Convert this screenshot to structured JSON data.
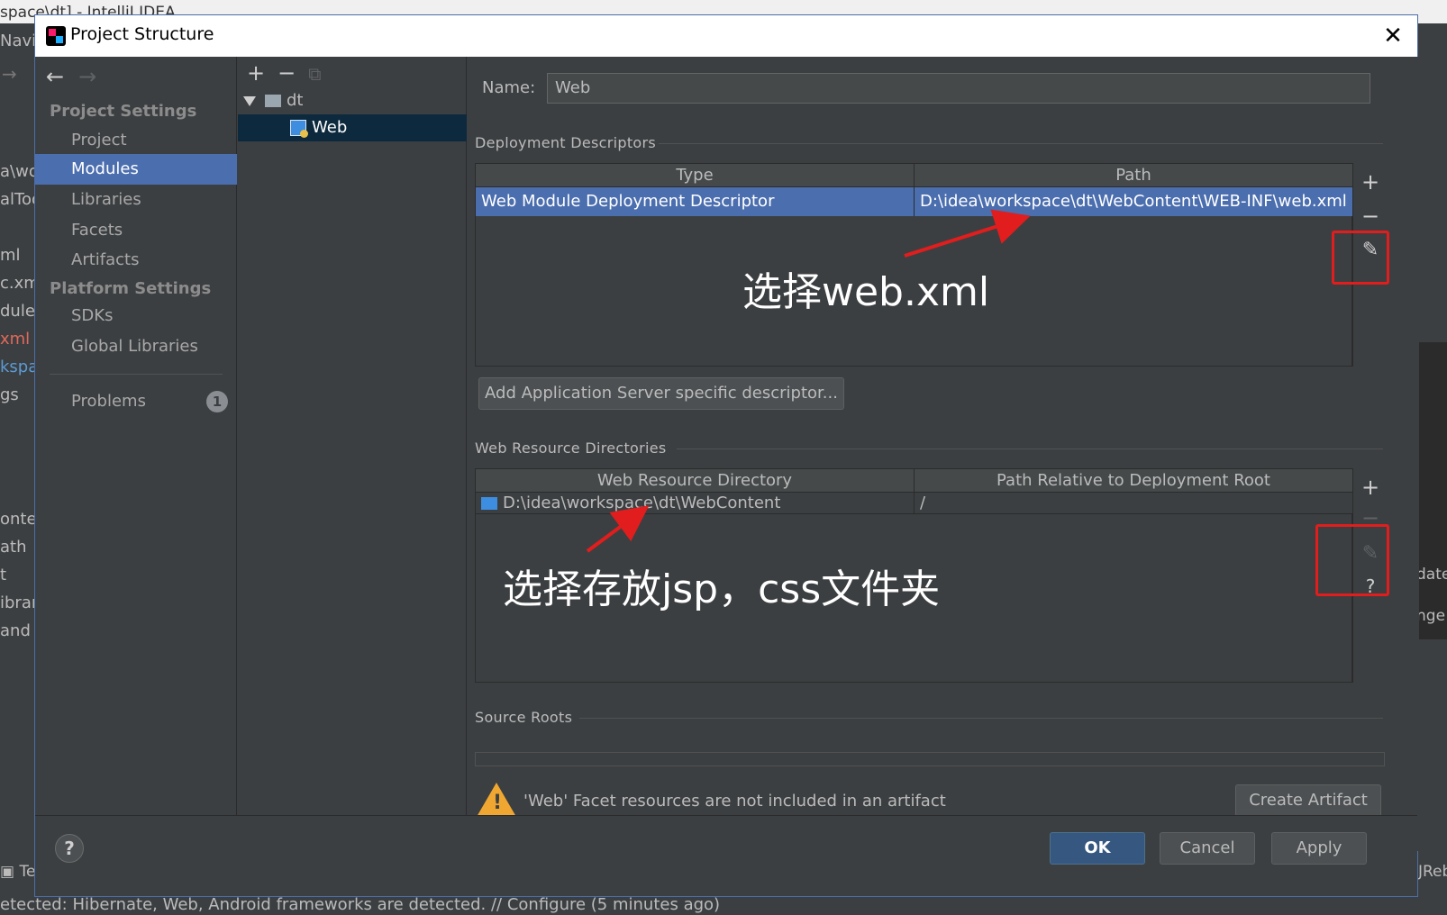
{
  "background_ide": {
    "title_fragment": "space\\dt] - IntelliJ IDEA",
    "menu_fragment": "Navig",
    "left_items": [
      "a\\wo",
      "alToo",
      "",
      "ml",
      "c.xm",
      "dules",
      "xml",
      "kspa",
      "gs"
    ],
    "left_items2": [
      "onten",
      "ath",
      "t",
      "ibrar",
      "and"
    ],
    "right_fragments": [
      "date",
      "nge"
    ],
    "bottom_tool": "Te",
    "bottom_tool_right": "JReb",
    "status_text": "etected: Hibernate, Web, Android frameworks are detected. // Configure (5 minutes ago)"
  },
  "dialog": {
    "title": "Project Structure",
    "close_glyph": "✕"
  },
  "nav": {
    "back_glyph": "←",
    "forward_glyph": "→",
    "sections": [
      {
        "title": "Project Settings",
        "items": [
          "Project",
          "Modules",
          "Libraries",
          "Facets",
          "Artifacts"
        ]
      },
      {
        "title": "Platform Settings",
        "items": [
          "SDKs",
          "Global Libraries"
        ]
      }
    ],
    "selected": "Modules",
    "problems_label": "Problems",
    "problems_count": "1"
  },
  "tree": {
    "toolbar": {
      "add": "+",
      "remove": "−",
      "copy": "⧉"
    },
    "root": "dt",
    "child": "Web"
  },
  "content": {
    "name_label": "Name:",
    "name_value": "Web",
    "deployment": {
      "title": "Deployment Descriptors",
      "columns": [
        "Type",
        "Path"
      ],
      "rows": [
        {
          "type": "Web Module Deployment Descriptor",
          "path": "D:\\idea\\workspace\\dt\\WebContent\\WEB-INF\\web.xml"
        }
      ],
      "add_server_button": "Add Application Server specific descriptor..."
    },
    "web_resources": {
      "title": "Web Resource Directories",
      "columns": [
        "Web Resource Directory",
        "Path Relative to Deployment Root"
      ],
      "rows": [
        {
          "dir": "D:\\idea\\workspace\\dt\\WebContent",
          "rel": "/"
        }
      ]
    },
    "source_roots_title": "Source Roots",
    "warning_text": "'Web' Facet resources are not included in an artifact",
    "create_artifact_button": "Create Artifact"
  },
  "side_buttons": {
    "add": "+",
    "remove": "−",
    "edit": "✎",
    "help": "?"
  },
  "footer": {
    "help": "?",
    "ok": "OK",
    "cancel": "Cancel",
    "apply": "Apply"
  },
  "annotations": {
    "note1": "选择web.xml",
    "note2": "选择存放jsp，css文件夹",
    "color": "#e11d1d"
  },
  "colors": {
    "selection": "#4b6eaf",
    "tree_selection": "#0d293e",
    "panel_bg": "#3c3f41",
    "warning": "#f0a732",
    "primary_button": "#365880"
  }
}
